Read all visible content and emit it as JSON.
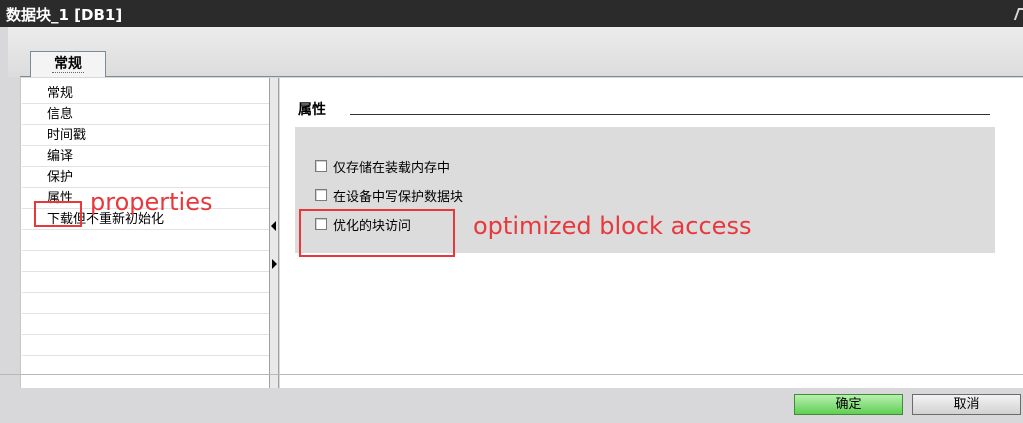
{
  "window": {
    "title": "数据块_1 [DB1]"
  },
  "tabs": [
    {
      "label": "常规"
    }
  ],
  "nav": {
    "items": [
      {
        "label": "常规"
      },
      {
        "label": "信息"
      },
      {
        "label": "时间戳"
      },
      {
        "label": "编译"
      },
      {
        "label": "保护"
      },
      {
        "label": "属性"
      },
      {
        "label": "下载但不重新初始化"
      }
    ]
  },
  "content": {
    "section_title": "属性",
    "options": [
      {
        "label": "仅存储在装载内存中",
        "checked": false
      },
      {
        "label": "在设备中写保护数据块",
        "checked": false
      },
      {
        "label": "优化的块访问",
        "checked": false
      }
    ]
  },
  "footer": {
    "ok_label": "确定",
    "cancel_label": "取消"
  },
  "annotations": {
    "properties": "properties",
    "optimized": "optimized block access",
    "color": "#e8383c"
  }
}
